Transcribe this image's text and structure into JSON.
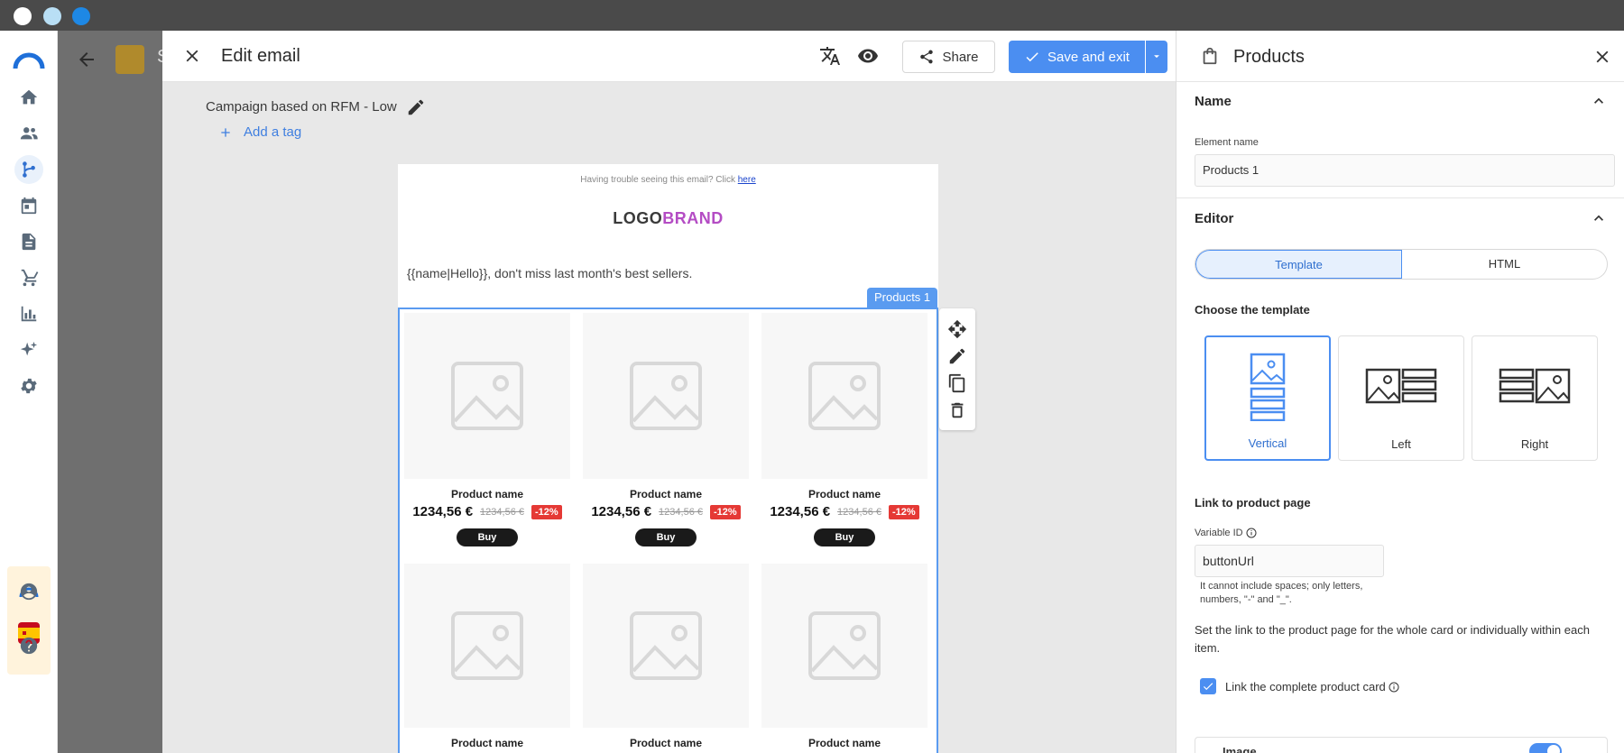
{
  "editor": {
    "title": "Edit email",
    "share_label": "Share",
    "save_label": "Save and exit",
    "campaign_title": "Campaign based on RFM - Low",
    "add_tag_label": "Add a tag"
  },
  "background_app": {
    "title_initial": "S"
  },
  "email": {
    "trouble_text": "Having trouble seeing this email? Click",
    "trouble_link": "here",
    "logo_part1": "LOGO",
    "logo_part2": "BRAND",
    "greeting": "{{name|Hello}}, don't miss last month's best sellers.",
    "products_tag": "Products 1",
    "products": [
      {
        "name": "Product name",
        "price": "1234,56 €",
        "old_price": "1234,56 €",
        "discount": "-12%",
        "buy": "Buy"
      },
      {
        "name": "Product name",
        "price": "1234,56 €",
        "old_price": "1234,56 €",
        "discount": "-12%",
        "buy": "Buy"
      },
      {
        "name": "Product name",
        "price": "1234,56 €",
        "old_price": "1234,56 €",
        "discount": "-12%",
        "buy": "Buy"
      },
      {
        "name": "Product name"
      },
      {
        "name": "Product name"
      },
      {
        "name": "Product name"
      }
    ]
  },
  "panel": {
    "title": "Products",
    "name_section": "Name",
    "element_name_label": "Element name",
    "element_name_value": "Products 1",
    "editor_section": "Editor",
    "tab_template": "Template",
    "tab_html": "HTML",
    "choose_template": "Choose the template",
    "templates": [
      {
        "label": "Vertical",
        "selected": true
      },
      {
        "label": "Left",
        "selected": false
      },
      {
        "label": "Right",
        "selected": false
      }
    ],
    "link_title": "Link to product page",
    "variable_id_label": "Variable ID",
    "variable_id_value": "buttonUrl",
    "hint": "It cannot include spaces; only letters, numbers, \"-\" and \"_\".",
    "description": "Set the link to the product page for the whole card or individually within each item.",
    "link_complete_label": "Link the complete product card",
    "link_complete_checked": true,
    "image_section": "Image"
  },
  "colors": {
    "accent": "#4b8ef1",
    "brand": "#b44cc4",
    "discount": "#e53935"
  }
}
